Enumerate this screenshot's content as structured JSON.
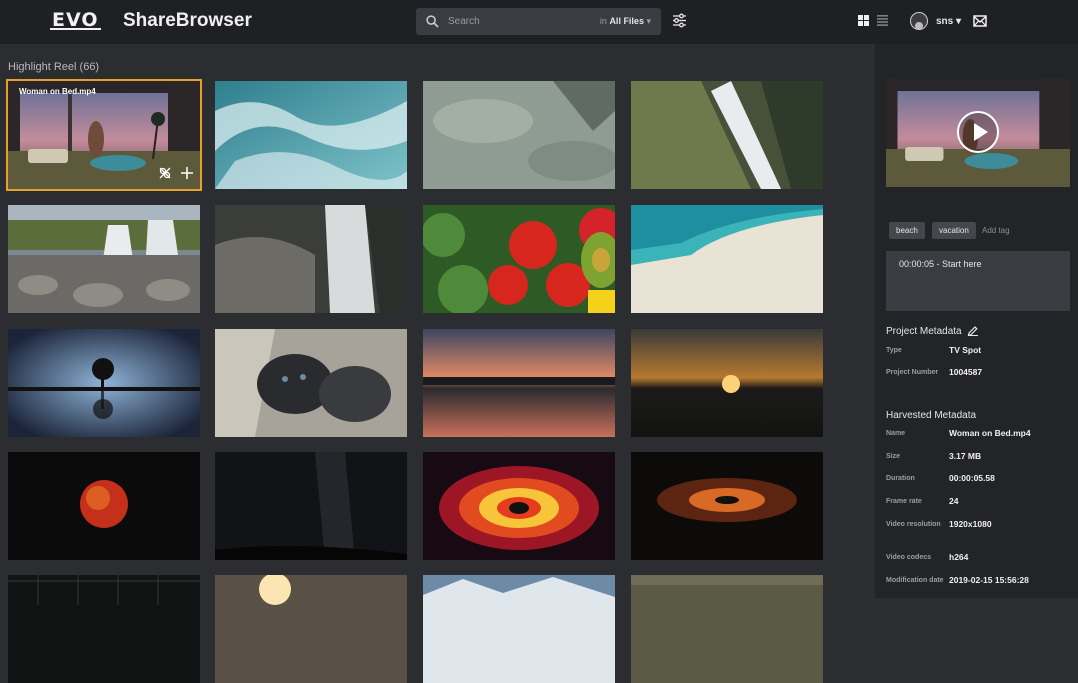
{
  "header": {
    "logo_text": "EVO",
    "app_name": "ShareBrowser",
    "search_placeholder": "Search",
    "search_scope_prefix": "in",
    "search_scope_value": "All Files",
    "user_name": "sns"
  },
  "reel": {
    "title": "Highlight Reel (66)",
    "selected_clip_label": "Woman on Bed.mp4",
    "thumbnails": [
      "woman-on-bed",
      "ocean-waves",
      "clear-water",
      "aerial-waterfall",
      "rocky-waterfall",
      "waterfall-closeup",
      "vegetables",
      "beach-aerial",
      "tree-reflection",
      "kittens",
      "lake-sunset",
      "sunset-silhouette",
      "red-planet",
      "milky-way",
      "galaxy-rings",
      "spiral-galaxy",
      "grid-lines",
      "sunburst",
      "mountains",
      "field"
    ]
  },
  "sidebar": {
    "tags": [
      "beach",
      "vacation"
    ],
    "add_tag": "Add tag",
    "note": "00:00:05 - Start here",
    "project_title": "Project Metadata",
    "project": [
      {
        "label": "Type",
        "value": "TV Spot"
      },
      {
        "label": "Project Number",
        "value": "1004587"
      }
    ],
    "harvested_title": "Harvested Metadata",
    "harvested": [
      {
        "label": "Name",
        "value": "Woman on Bed.mp4"
      },
      {
        "label": "Size",
        "value": "3.17 MB"
      },
      {
        "label": "Duration",
        "value": "00:00:05.58"
      },
      {
        "label": "Frame rate",
        "value": "24"
      },
      {
        "label": "Video resolution",
        "value": "1920x1080"
      },
      {
        "label": "Video codecs",
        "value": "h264"
      },
      {
        "label": "Modification date",
        "value": "2019-02-15 15:56:28"
      }
    ]
  },
  "colors": {
    "background": "#2b2d31",
    "topbar": "#1f2023",
    "sidebar": "#232428",
    "selection": "#e5a02d"
  }
}
